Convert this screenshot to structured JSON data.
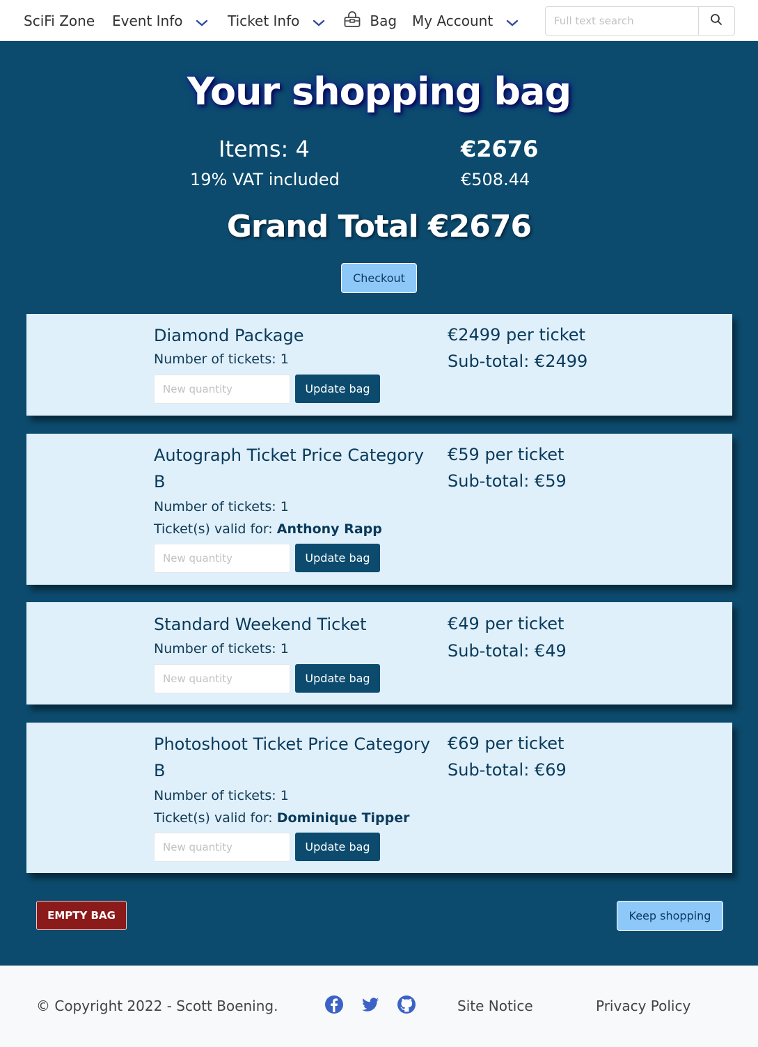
{
  "nav": {
    "brand": "SciFi Zone",
    "event_info": "Event Info",
    "ticket_info": "Ticket Info",
    "bag": "Bag",
    "my_account": "My Account",
    "search_placeholder": "Full text search"
  },
  "summary": {
    "title": "Your shopping bag",
    "items_label": "Items: 4",
    "total": "€2676",
    "vat_label": "19% VAT included",
    "vat_amount": "€508.44",
    "grand_total": "Grand Total €2676",
    "checkout_label": "Checkout"
  },
  "items": [
    {
      "name": "Diamond Package",
      "count": "Number of tickets: 1",
      "valid_label": "",
      "valid_name": "",
      "price": "€2499 per ticket",
      "subtotal": "Sub-total: €2499"
    },
    {
      "name": "Autograph Ticket Price Category B",
      "count": "Number of tickets: 1",
      "valid_label": "Ticket(s) valid for: ",
      "valid_name": "Anthony Rapp",
      "price": "€59 per ticket",
      "subtotal": "Sub-total: €59"
    },
    {
      "name": "Standard Weekend Ticket",
      "count": "Number of tickets: 1",
      "valid_label": "",
      "valid_name": "",
      "price": "€49 per ticket",
      "subtotal": "Sub-total: €49"
    },
    {
      "name": "Photoshoot Ticket Price Category B",
      "count": "Number of tickets: 1",
      "valid_label": "Ticket(s) valid for: ",
      "valid_name": "Dominique Tipper",
      "price": "€69 per ticket",
      "subtotal": "Sub-total: €69"
    }
  ],
  "item_controls": {
    "qty_placeholder": "New quantity",
    "update_label": "Update bag"
  },
  "actions": {
    "empty_bag": "EMPTY BAG",
    "keep_shopping": "Keep shopping"
  },
  "footer": {
    "copyright": "© Copyright 2022 - Scott Boening.",
    "site_notice": "Site Notice",
    "privacy_policy": "Privacy Policy",
    "social_icons": [
      "facebook-icon",
      "twitter-icon",
      "github-icon"
    ]
  },
  "colors": {
    "page_bg": "#0c4b6e",
    "card_bg": "#dff0fb",
    "accent_button": "#8ec8f9",
    "danger": "#8b1a1a",
    "social_icon": "#3b62c4"
  }
}
